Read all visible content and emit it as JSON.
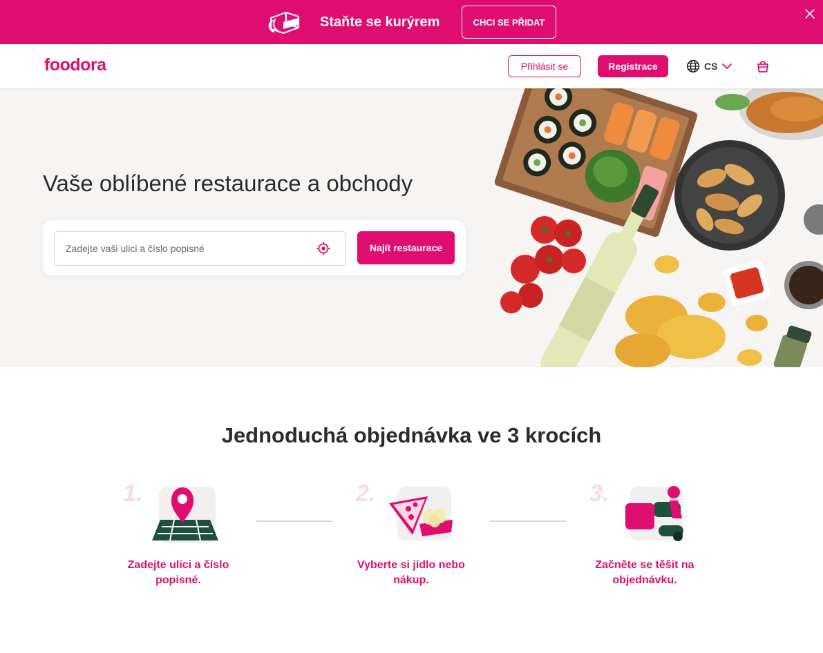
{
  "promo": {
    "text": "Staňte se kurýrem",
    "button": "CHCI SE PŘIDAT",
    "icon": "delivery-bag-icon"
  },
  "header": {
    "logo": "foodora",
    "login": "Přihlásit se",
    "register": "Registrace",
    "language": "CS"
  },
  "hero": {
    "title": "Vaše oblíbené restaurace a obchody",
    "search_placeholder": "Zadejte vaši ulici a číslo popisné",
    "search_button": "Najít restaurace"
  },
  "steps": {
    "title": "Jednoduchá objednávka ve 3 krocích",
    "items": [
      {
        "number": "1.",
        "text": "Zadejte ulici a číslo popisné.",
        "icon": "map-pin-icon"
      },
      {
        "number": "2.",
        "text": "Vyberte si jídlo nebo nákup.",
        "icon": "pizza-groceries-icon"
      },
      {
        "number": "3.",
        "text": "Začněte se těšit na objednávku.",
        "icon": "courier-scooter-icon"
      }
    ]
  },
  "colors": {
    "brand": "#df0d6f",
    "hero_bg": "#f7f5f3",
    "step_number": "#fbd8e6"
  }
}
